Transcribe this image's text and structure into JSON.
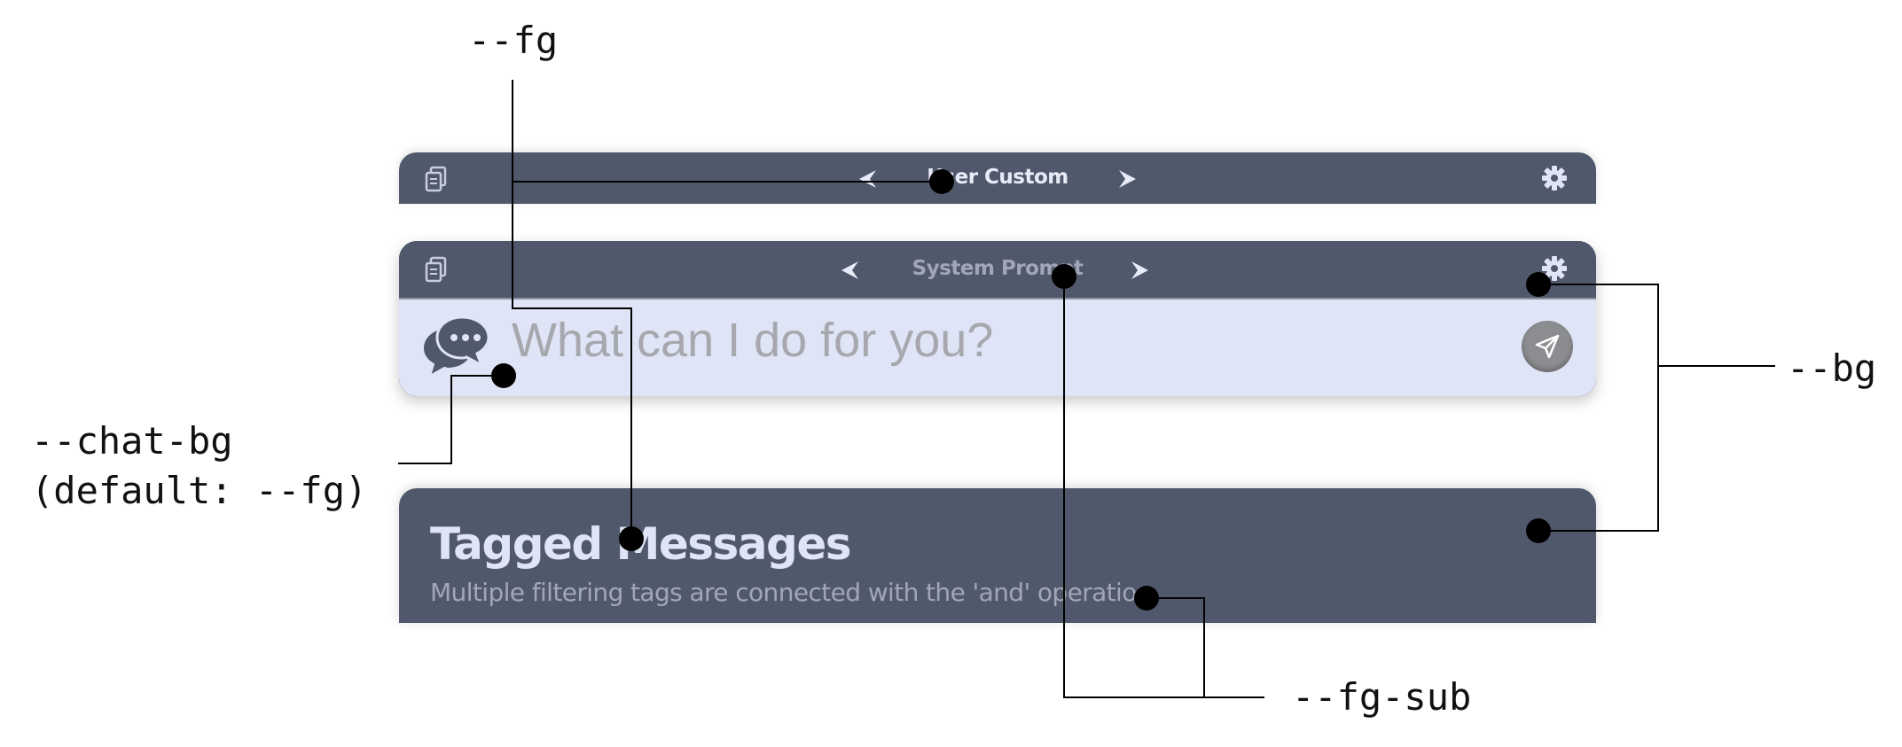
{
  "colors": {
    "bg": "#50586b",
    "fg": "#dfe4f6",
    "fg_sub": "#a2a7b7",
    "chat_bg": "#dfe4f6",
    "annotation": "#000000"
  },
  "panels": {
    "top": {
      "title": "User Custom",
      "left_icon": "copy-pages-icon",
      "prev_icon": "chevron-left-icon",
      "next_icon": "chevron-right-icon",
      "right_icon": "gear-icon"
    },
    "middle": {
      "title": "System Prompt",
      "left_icon": "copy-pages-icon",
      "prev_icon": "chevron-left-icon",
      "next_icon": "chevron-right-icon",
      "right_icon": "gear-icon",
      "chat_icon": "chat-bubbles-icon",
      "chat_placeholder": "What can I do for you?",
      "send_icon": "paper-plane-icon"
    },
    "bottom": {
      "title": "Tagged Messages",
      "subtitle": "Multiple filtering tags are connected with the 'and' operation."
    }
  },
  "annotations": {
    "fg": "--fg",
    "chat_bg_line1": "--chat-bg",
    "chat_bg_line2": "(default: --fg)",
    "bg": "--bg",
    "fg_sub": "--fg-sub"
  }
}
